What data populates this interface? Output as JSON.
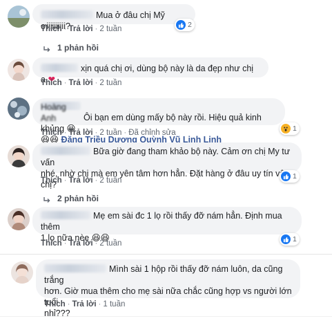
{
  "comments": [
    {
      "text": "Mua ở đâu chị Mỹ ơiiiiiiiiii?",
      "actions": {
        "like": "Thích",
        "reply": "Trả lời",
        "time": "2 tuần"
      },
      "reaction_count": "2",
      "replies_label": "1 phản hồi"
    },
    {
      "text": "xịn quá chị ơi, dùng bộ này là da đẹp như chị a",
      "actions": {
        "like": "Thích",
        "reply": "Trả lời",
        "time": "2 tuần"
      }
    },
    {
      "name": "Hoàng Anh",
      "text": "Ôi bạn em dùng mấy bộ này rồi. Hiệu quả kinh khủng",
      "tags": "Đặng Triều Dương Quỳnh Vũ Linh Linh",
      "actions": {
        "like": "Thích",
        "reply": "Trả lời",
        "time": "2 tuần",
        "edited": "Đã chỉnh sửa"
      },
      "reaction_count": "1"
    },
    {
      "text_line1": "Bữa giờ đang tham khảo bộ này. Cảm ơn chị My tư vấn",
      "text_line2": "nhé, nhờ chị mà em yên tâm hơn hẳn. Đặt hàng ở đâu uy tín vậy chị?",
      "actions": {
        "like": "Thích",
        "reply": "Trả lời",
        "time": "2 tuần"
      },
      "reaction_count": "1",
      "replies_label": "2 phản hồi"
    },
    {
      "text_line1": "Mẹ em sài đc 1 lọ rồi thấy đỡ nám hẳn. Định mua thêm",
      "text_line2": "1 lọ nữa nèe",
      "actions": {
        "like": "Thích",
        "reply": "Trả lời",
        "time": "2 tuần"
      },
      "reaction_count": "1"
    },
    {
      "text_line1": "Mình sài 1 hộp rồi thấy đỡ nám luôn, da cũng trắng",
      "text_line2": "hơn. Giờ mua thêm cho mẹ sài nữa chắc cũng hợp vs người lớn tuổi",
      "text_line3": "nhỉ???",
      "actions": {
        "like": "Thích",
        "reply": "Trả lời",
        "time": "1 tuần"
      }
    }
  ]
}
